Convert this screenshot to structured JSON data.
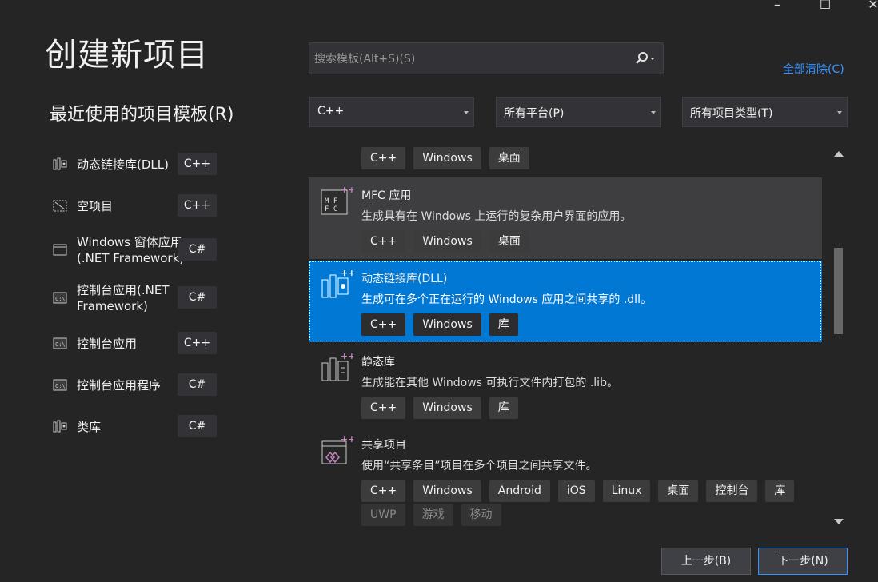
{
  "window": {
    "minimize_glyph": "–",
    "maximize_glyph": "☐",
    "close_glyph": "✕"
  },
  "page_title": "创建新项目",
  "recent": {
    "title": "最近使用的项目模板(R)",
    "items": [
      {
        "label": "动态链接库(DLL)",
        "lang": "C++",
        "icon": "dll-library-icon"
      },
      {
        "label": "空项目",
        "lang": "C++",
        "icon": "empty-project-icon"
      },
      {
        "label": "Windows 窗体应用 (.NET Framework)",
        "lang": "C#",
        "icon": "windows-form-icon"
      },
      {
        "label": "控制台应用(.NET Framework)",
        "lang": "C#",
        "icon": "console-app-icon"
      },
      {
        "label": "控制台应用",
        "lang": "C++",
        "icon": "console-app-icon"
      },
      {
        "label": "控制台应用程序",
        "lang": "C#",
        "icon": "console-app-icon"
      },
      {
        "label": "类库",
        "lang": "C#",
        "icon": "class-library-icon"
      }
    ]
  },
  "search": {
    "placeholder": "搜索模板(Alt+S)(S)",
    "value": ""
  },
  "clear_all": "全部清除(C)",
  "filters": {
    "language": "C++",
    "platform": "所有平台(P)",
    "project_type": "所有项目类型(T)"
  },
  "templates": [
    {
      "name": "",
      "desc": "",
      "tags": [
        "C++",
        "Windows",
        "桌面"
      ]
    },
    {
      "name": "MFC 应用",
      "desc": "生成具有在 Windows 上运行的复杂用户界面的应用。",
      "tags": [
        "C++",
        "Windows",
        "桌面"
      ]
    },
    {
      "name": "动态链接库(DLL)",
      "desc": "生成可在多个正在运行的 Windows 应用之间共享的 .dll。",
      "tags": [
        "C++",
        "Windows",
        "库"
      ]
    },
    {
      "name": "静态库",
      "desc": "生成能在其他 Windows 可执行文件内打包的 .lib。",
      "tags": [
        "C++",
        "Windows",
        "库"
      ]
    },
    {
      "name": "共享项目",
      "desc": "使用“共享条目”项目在多个项目之间共享文件。",
      "tags": [
        "C++",
        "Windows",
        "Android",
        "iOS",
        "Linux",
        "桌面",
        "控制台",
        "库"
      ],
      "tags_dim": [
        "UWP",
        "游戏",
        "移动"
      ]
    }
  ],
  "buttons": {
    "back": "上一步(B)",
    "next": "下一步(N)"
  },
  "colors": {
    "background": "#252526",
    "selected": "#0078d4",
    "link": "#3794ff",
    "icon_accent": "#c586c0"
  }
}
